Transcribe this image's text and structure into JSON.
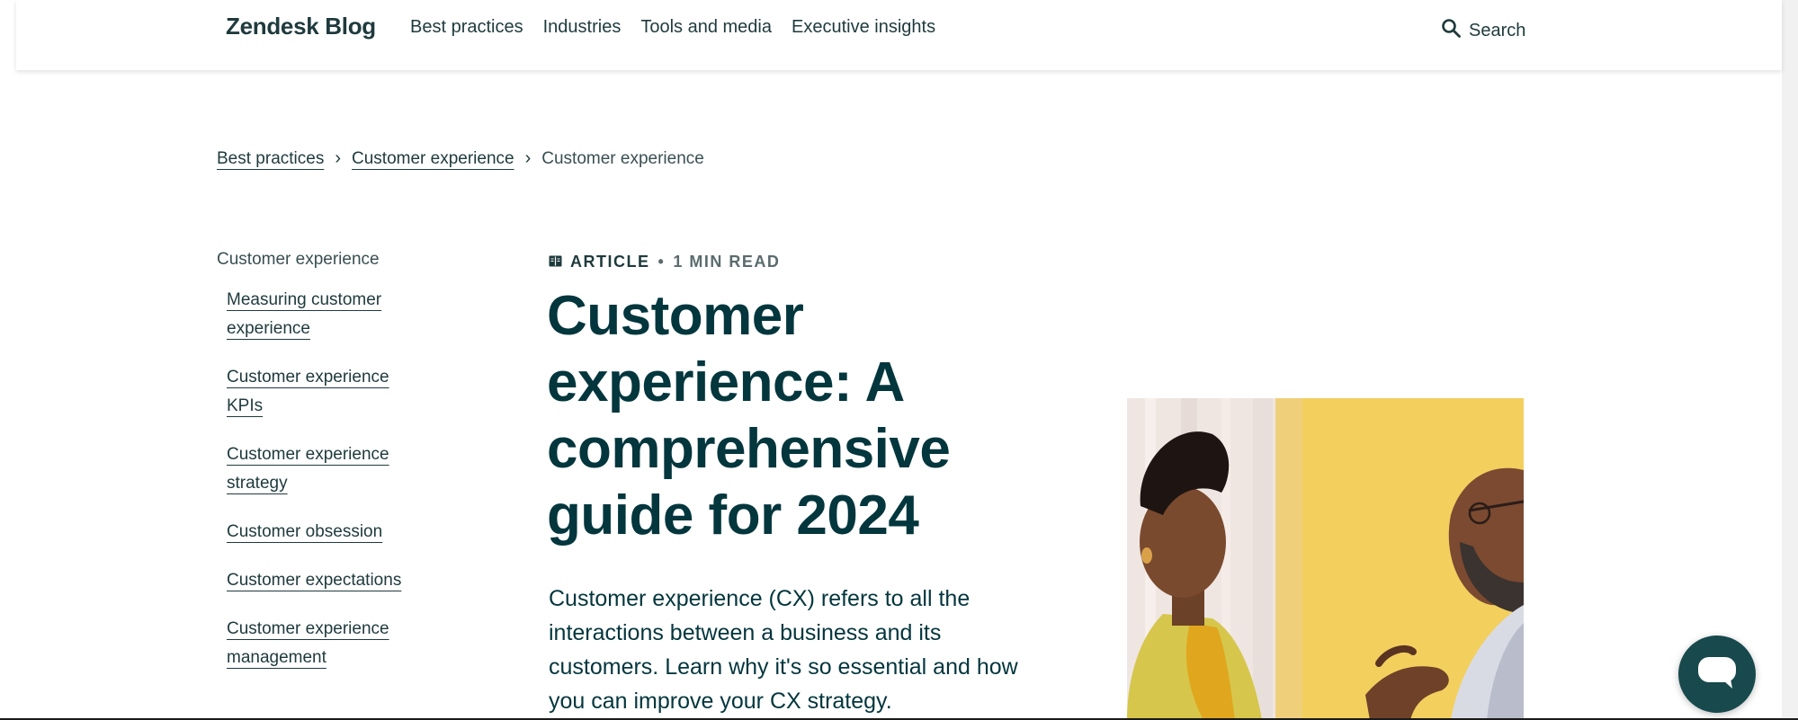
{
  "header": {
    "brand": "Zendesk Blog",
    "nav": [
      "Best practices",
      "Industries",
      "Tools and media",
      "Executive insights"
    ],
    "search_label": "Search"
  },
  "breadcrumb": {
    "items": [
      "Best practices",
      "Customer experience"
    ],
    "current": "Customer experience",
    "separator": "›"
  },
  "sidebar": {
    "heading": "Customer experience",
    "items": [
      "Measuring customer experience",
      "Customer experience KPIs",
      "Customer experience strategy",
      "Customer obsession",
      "Customer expectations",
      "Customer experience management"
    ]
  },
  "article": {
    "type": "ARTICLE",
    "separator": "•",
    "read_time": "1 MIN READ",
    "title": "Customer experience: A comprehensive guide for 2024",
    "lede": "Customer experience (CX) refers to all the interactions between a business and its customers. Learn why it's so essential and how you can improve your CX strategy."
  },
  "colors": {
    "brand_dark": "#03363d",
    "chat_button": "#17494d",
    "hero_yellow": "#f3cf5e"
  },
  "icons": {
    "search": "search-icon",
    "article": "book-icon",
    "chat": "chat-bubble-icon"
  }
}
